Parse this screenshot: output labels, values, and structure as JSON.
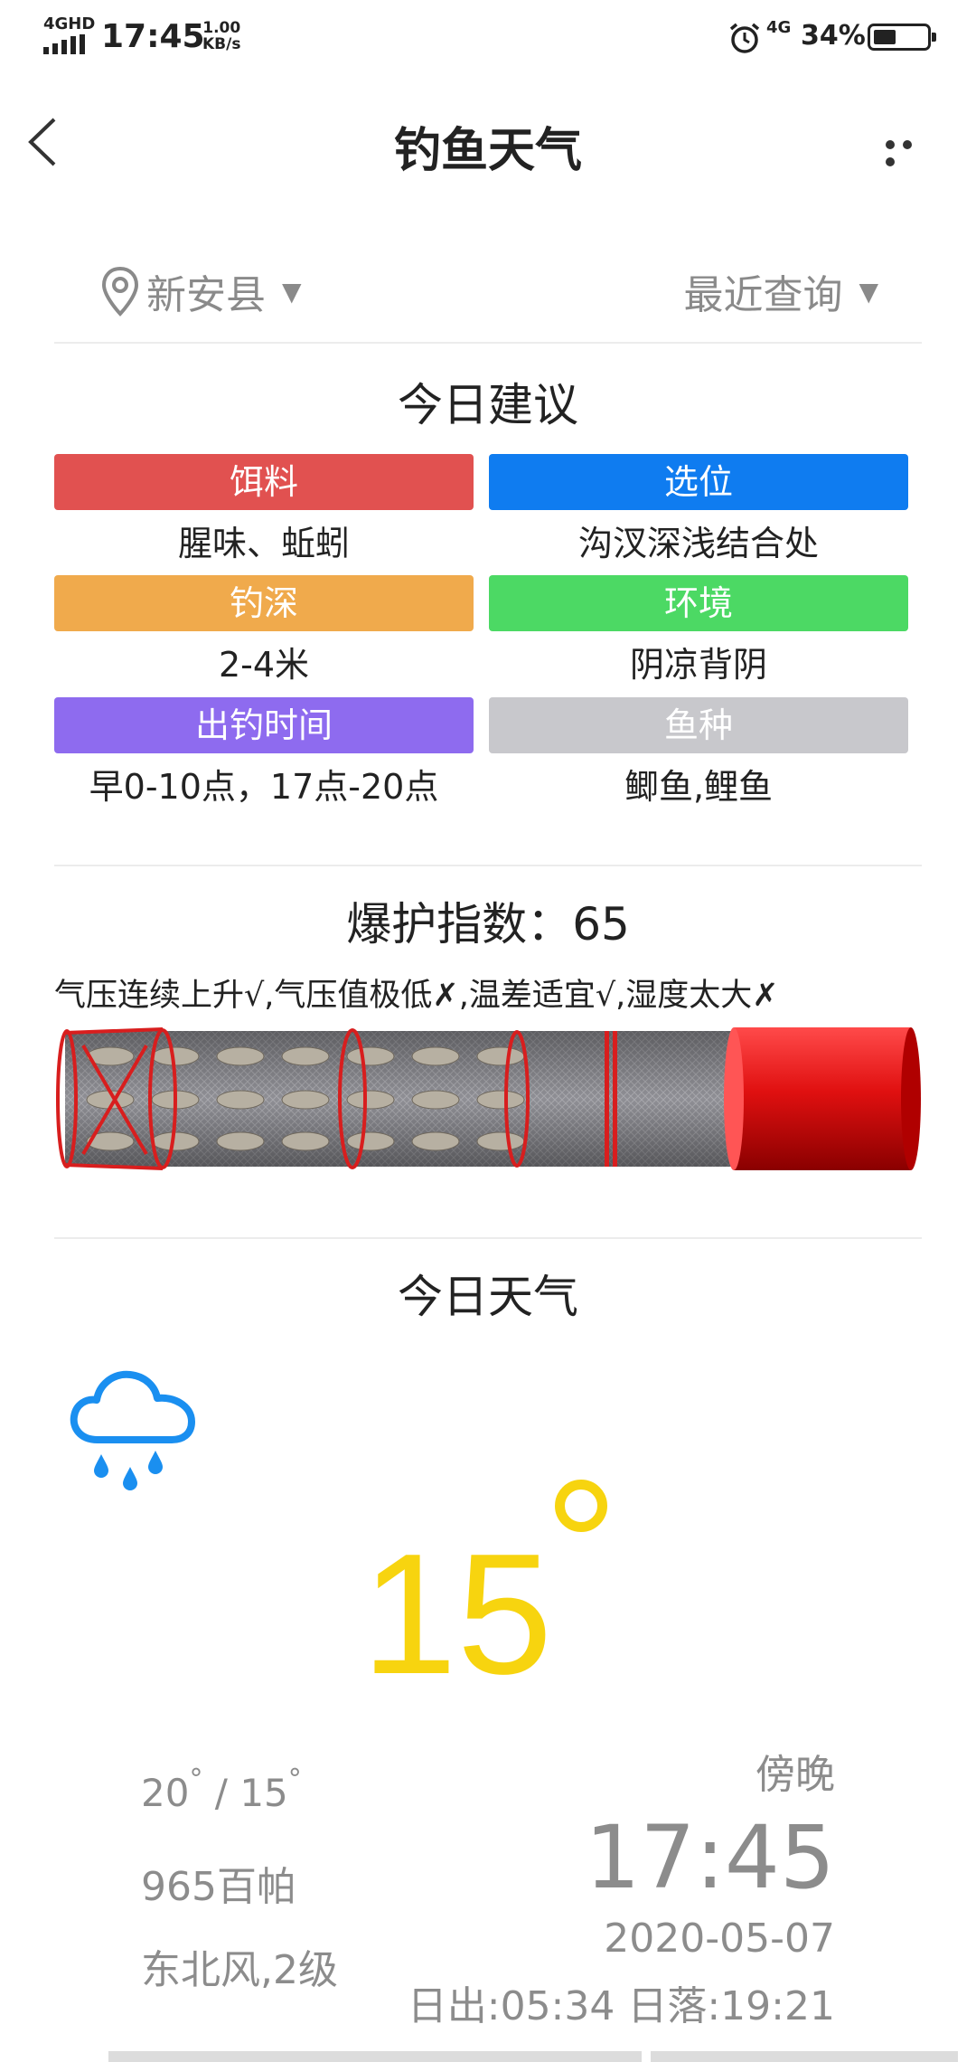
{
  "status_bar": {
    "network_type": "4GHD",
    "time": "17:45",
    "speed_value": "1.00",
    "speed_unit": "KB/s",
    "data_network": "4G",
    "battery": "34%"
  },
  "header": {
    "title": "钓鱼天气"
  },
  "location": {
    "city": "新安县",
    "recent": "最近查询"
  },
  "advice": {
    "title": "今日建议",
    "items": [
      {
        "label": "饵料",
        "value": "腥味、蚯蚓",
        "color": "#e15150"
      },
      {
        "label": "选位",
        "value": "沟汊深浅结合处",
        "color": "#0f7cf0"
      },
      {
        "label": "钓深",
        "value": "2-4米",
        "color": "#f0aa4c"
      },
      {
        "label": "环境",
        "value": "阴凉背阴",
        "color": "#4cd964"
      },
      {
        "label": "出钓时间",
        "value": "早0-10点，17点-20点",
        "color": "#8e6bef"
      },
      {
        "label": "鱼种",
        "value": "鲫鱼,鲤鱼",
        "color": "#c8c8cc"
      }
    ]
  },
  "index": {
    "label": "爆护指数：",
    "value": "65",
    "conditions": "气压连续上升√,气压值极低✗,温差适宜√,湿度太大✗"
  },
  "weather": {
    "title": "今日天气",
    "icon": "rain-cloud-icon",
    "temperature": "15",
    "range_high": "20",
    "range_sep": " / ",
    "range_low": "15",
    "pressure": "965百帕",
    "wind": "东北风,2级",
    "period": "傍晚",
    "time": "17:45",
    "date": "2020-05-07",
    "sun": "日出:05:34 日落:19:21"
  },
  "colors": {
    "temperature": "#f7d40f",
    "icon_blue": "#1a8ff0",
    "secondary_text": "#8c8c8c"
  }
}
